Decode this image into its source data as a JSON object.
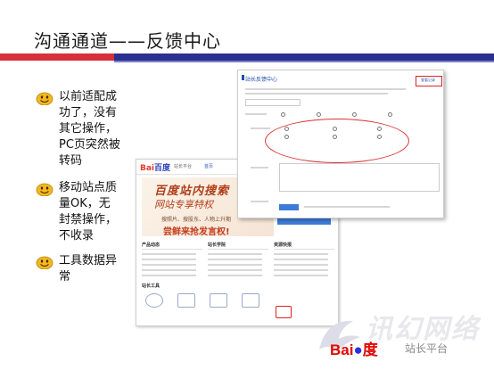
{
  "slide": {
    "title": "沟通通道——反馈中心",
    "bullets": [
      "以前适配成\n功了，没有\n其它操作，\nPC页突然被\n转码",
      "移动站点质\n量OK，无\n封禁操作，\n不收录",
      "工具数据异\n常"
    ],
    "colors": {
      "accent_red": "#d7303a",
      "accent_blue": "#2b2f8f",
      "smiley": "#f2b81f"
    }
  },
  "feedback_panel": {
    "header": "站长反馈中心",
    "button": "查看记录"
  },
  "portal_panel": {
    "logo_text": "Bai",
    "logo_du": "百度",
    "nav_item": "站长平台",
    "nav_item2": "首页",
    "banner_line1": "百度站内搜索",
    "banner_line2": "网站专享特权",
    "banner_small": "搜照片、搜股东、人物上升期",
    "banner_big": "尝鲜来抢发言权!",
    "col1": "产品动态",
    "col2": "站长学院",
    "col3": "资源快报",
    "tools_label": "站长工具"
  },
  "watermark": {
    "brand": "讯幻网络",
    "brand_logo_text": "Bai",
    "brand_logo_suffix": "度",
    "sub": "站长平台"
  }
}
